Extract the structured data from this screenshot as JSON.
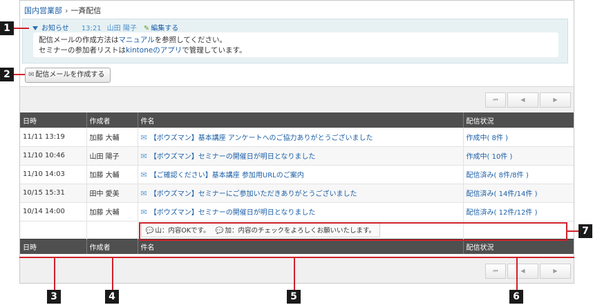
{
  "breadcrumb": {
    "parent": "国内営業部",
    "separator": "›",
    "current": "一斉配信"
  },
  "notice": {
    "title": "お知らせ",
    "time": "13:21",
    "user": "山田 陽子",
    "edit": "編集する",
    "line1_a": "配信メールの作成方法は",
    "line1_link": "マニュアル",
    "line1_b": "を参照してください。",
    "line2_a": "セミナーの参加者リストは",
    "line2_link": "kintoneのアプリ",
    "line2_b": "で管理しています。"
  },
  "create_button": "配信メールを作成する",
  "columns": {
    "date": "日時",
    "author": "作成者",
    "subject": "件名",
    "status": "配信状況"
  },
  "rows": [
    {
      "date": "11/11 13:19",
      "author": "加藤 大輔",
      "subject": "【ボウズマン】基本講座 アンケートへのご協力ありがとうございました",
      "status": "作成中( 8件 )"
    },
    {
      "date": "11/10 10:46",
      "author": "山田 陽子",
      "subject": "【ボウズマン】セミナーの開催日が明日となりました",
      "status": "作成中( 10件 )"
    },
    {
      "date": "11/10 14:03",
      "author": "加藤 大輔",
      "subject": "【ご確認ください】基本講座 参加用URLのご案内",
      "status": "配信済み( 8件/8件 )"
    },
    {
      "date": "10/15 15:31",
      "author": "田中 愛美",
      "subject": "【ボウズマン】セミナーにご参加いただきありがとうございました",
      "status": "配信済み( 14件/14件 )"
    },
    {
      "date": "10/14 14:00",
      "author": "加藤 大輔",
      "subject": "【ボウズマン】セミナーの開催日が明日となりました",
      "status": "配信済み( 12件/12件 )"
    }
  ],
  "comments": {
    "c1": "山：内容OKです。",
    "c2": "加：内容のチェックをよろしくお願いいたします。"
  },
  "pager": {
    "first": "⏮",
    "prev": "◀",
    "next": "▶"
  },
  "callouts": {
    "n1": "1",
    "n2": "2",
    "n3": "3",
    "n4": "4",
    "n5": "5",
    "n6": "6",
    "n7": "7"
  },
  "icons": {
    "notice_toggle": "triangle-down-icon",
    "edit": "pencil-icon",
    "mail": "mail-icon",
    "subject": "message-icon",
    "comment": "speech-bubble-icon"
  },
  "colors": {
    "link": "#1a5ea6",
    "header_bg": "#4f4f4f",
    "notice_bg": "#e7f1f4",
    "callout_line": "#d0202a"
  }
}
